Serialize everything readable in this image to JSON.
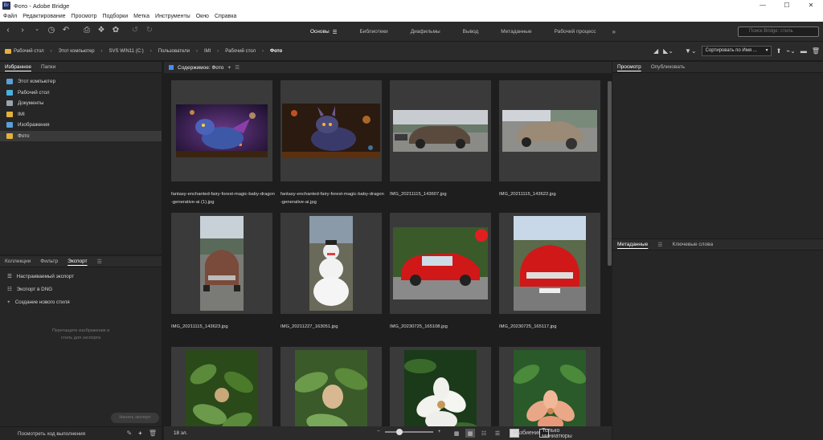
{
  "window": {
    "title": "Фото - Adobe Bridge",
    "app_badge": "Br",
    "minimize": "—",
    "maximize": "☐",
    "close": "✕"
  },
  "menu": [
    "Файл",
    "Редактирование",
    "Просмотр",
    "Подборки",
    "Метка",
    "Инструменты",
    "Окно",
    "Справка"
  ],
  "workspace_tabs": [
    {
      "label": "Основы",
      "active": true
    },
    {
      "label": "Библиотеки"
    },
    {
      "label": "Диафильмы"
    },
    {
      "label": "Вывод"
    },
    {
      "label": "Метаданные"
    },
    {
      "label": "Рабочий процесс"
    }
  ],
  "workspace_more": "»",
  "search": {
    "placeholder": "Поиск Bridge: стиль"
  },
  "breadcrumb": [
    "Рабочий стол",
    "Этот компьютер",
    "SVS WIN11 (C:)",
    "Пользователи",
    "IMI",
    "Рабочий стол",
    "Фото"
  ],
  "sort": {
    "label": "Сортировать по Имя ..."
  },
  "left_top_tabs": [
    "Избранное",
    "Папки"
  ],
  "favorites": [
    {
      "label": "Этот компьютер",
      "icon": "computer-icon",
      "color": "#5aa0d8"
    },
    {
      "label": "Рабочий стол",
      "icon": "desktop-icon",
      "color": "#4ab0e0"
    },
    {
      "label": "Документы",
      "icon": "documents-icon",
      "color": "#9aa4b0"
    },
    {
      "label": "IMI",
      "icon": "folder-icon",
      "color": "#e3b23c"
    },
    {
      "label": "Изображения",
      "icon": "pictures-icon",
      "color": "#5aa0d8"
    },
    {
      "label": "Фото",
      "icon": "folder-icon",
      "color": "#e3b23c",
      "selected": true
    }
  ],
  "left_bottom_tabs": [
    "Коллекции",
    "Фильтр",
    "Экспорт"
  ],
  "export_items": [
    {
      "label": "Настраиваемый экспорт",
      "icon": "custom-export-icon",
      "glyph": "☰"
    },
    {
      "label": "Экспорт в DNG",
      "icon": "dng-export-icon",
      "glyph": "☷"
    },
    {
      "label": "Создание нового стиля",
      "icon": "plus-icon",
      "glyph": "+"
    }
  ],
  "export_hint": [
    "Перетащите изображения в",
    "стиль для экспорта"
  ],
  "export_button": "Начать экспорт",
  "progress_label": "Посмотреть ход выполнения",
  "content_title": "Содержимое: Фото",
  "files": [
    {
      "name": "fantasy-enchanted-fairy-forest-magic-baby-dragon-generative-ai (1).jpg"
    },
    {
      "name": "fantasy-enchanted-fairy-forest-magic-baby-dragon-generative-ai.jpg"
    },
    {
      "name": "IMG_20211115_143607.jpg"
    },
    {
      "name": "IMG_20211115_143622.jpg"
    },
    {
      "name": "IMG_20211115_143623.jpg"
    },
    {
      "name": "IMG_20211227_163051.jpg"
    },
    {
      "name": "IMG_20230725_165108.jpg"
    },
    {
      "name": "IMG_20230725_165117.jpg"
    },
    {
      "name": ""
    },
    {
      "name": ""
    },
    {
      "name": ""
    },
    {
      "name": ""
    }
  ],
  "item_count": "18 эл.",
  "footer": {
    "split_label": "Разбиение",
    "thumbs_only_label": "Только миниатюры",
    "zoom_minus": "−",
    "zoom_plus": "+",
    "split_checked": true,
    "thumbs_only_checked": false
  },
  "right_top_tabs": [
    "Просмотр",
    "Опубликовать"
  ],
  "right_bottom_tabs": [
    "Метаданные",
    "Ключевые слова"
  ],
  "colors": {
    "accent": "#4b8bf5",
    "arrow": "#e0564a",
    "folder": "#e3b23c"
  }
}
